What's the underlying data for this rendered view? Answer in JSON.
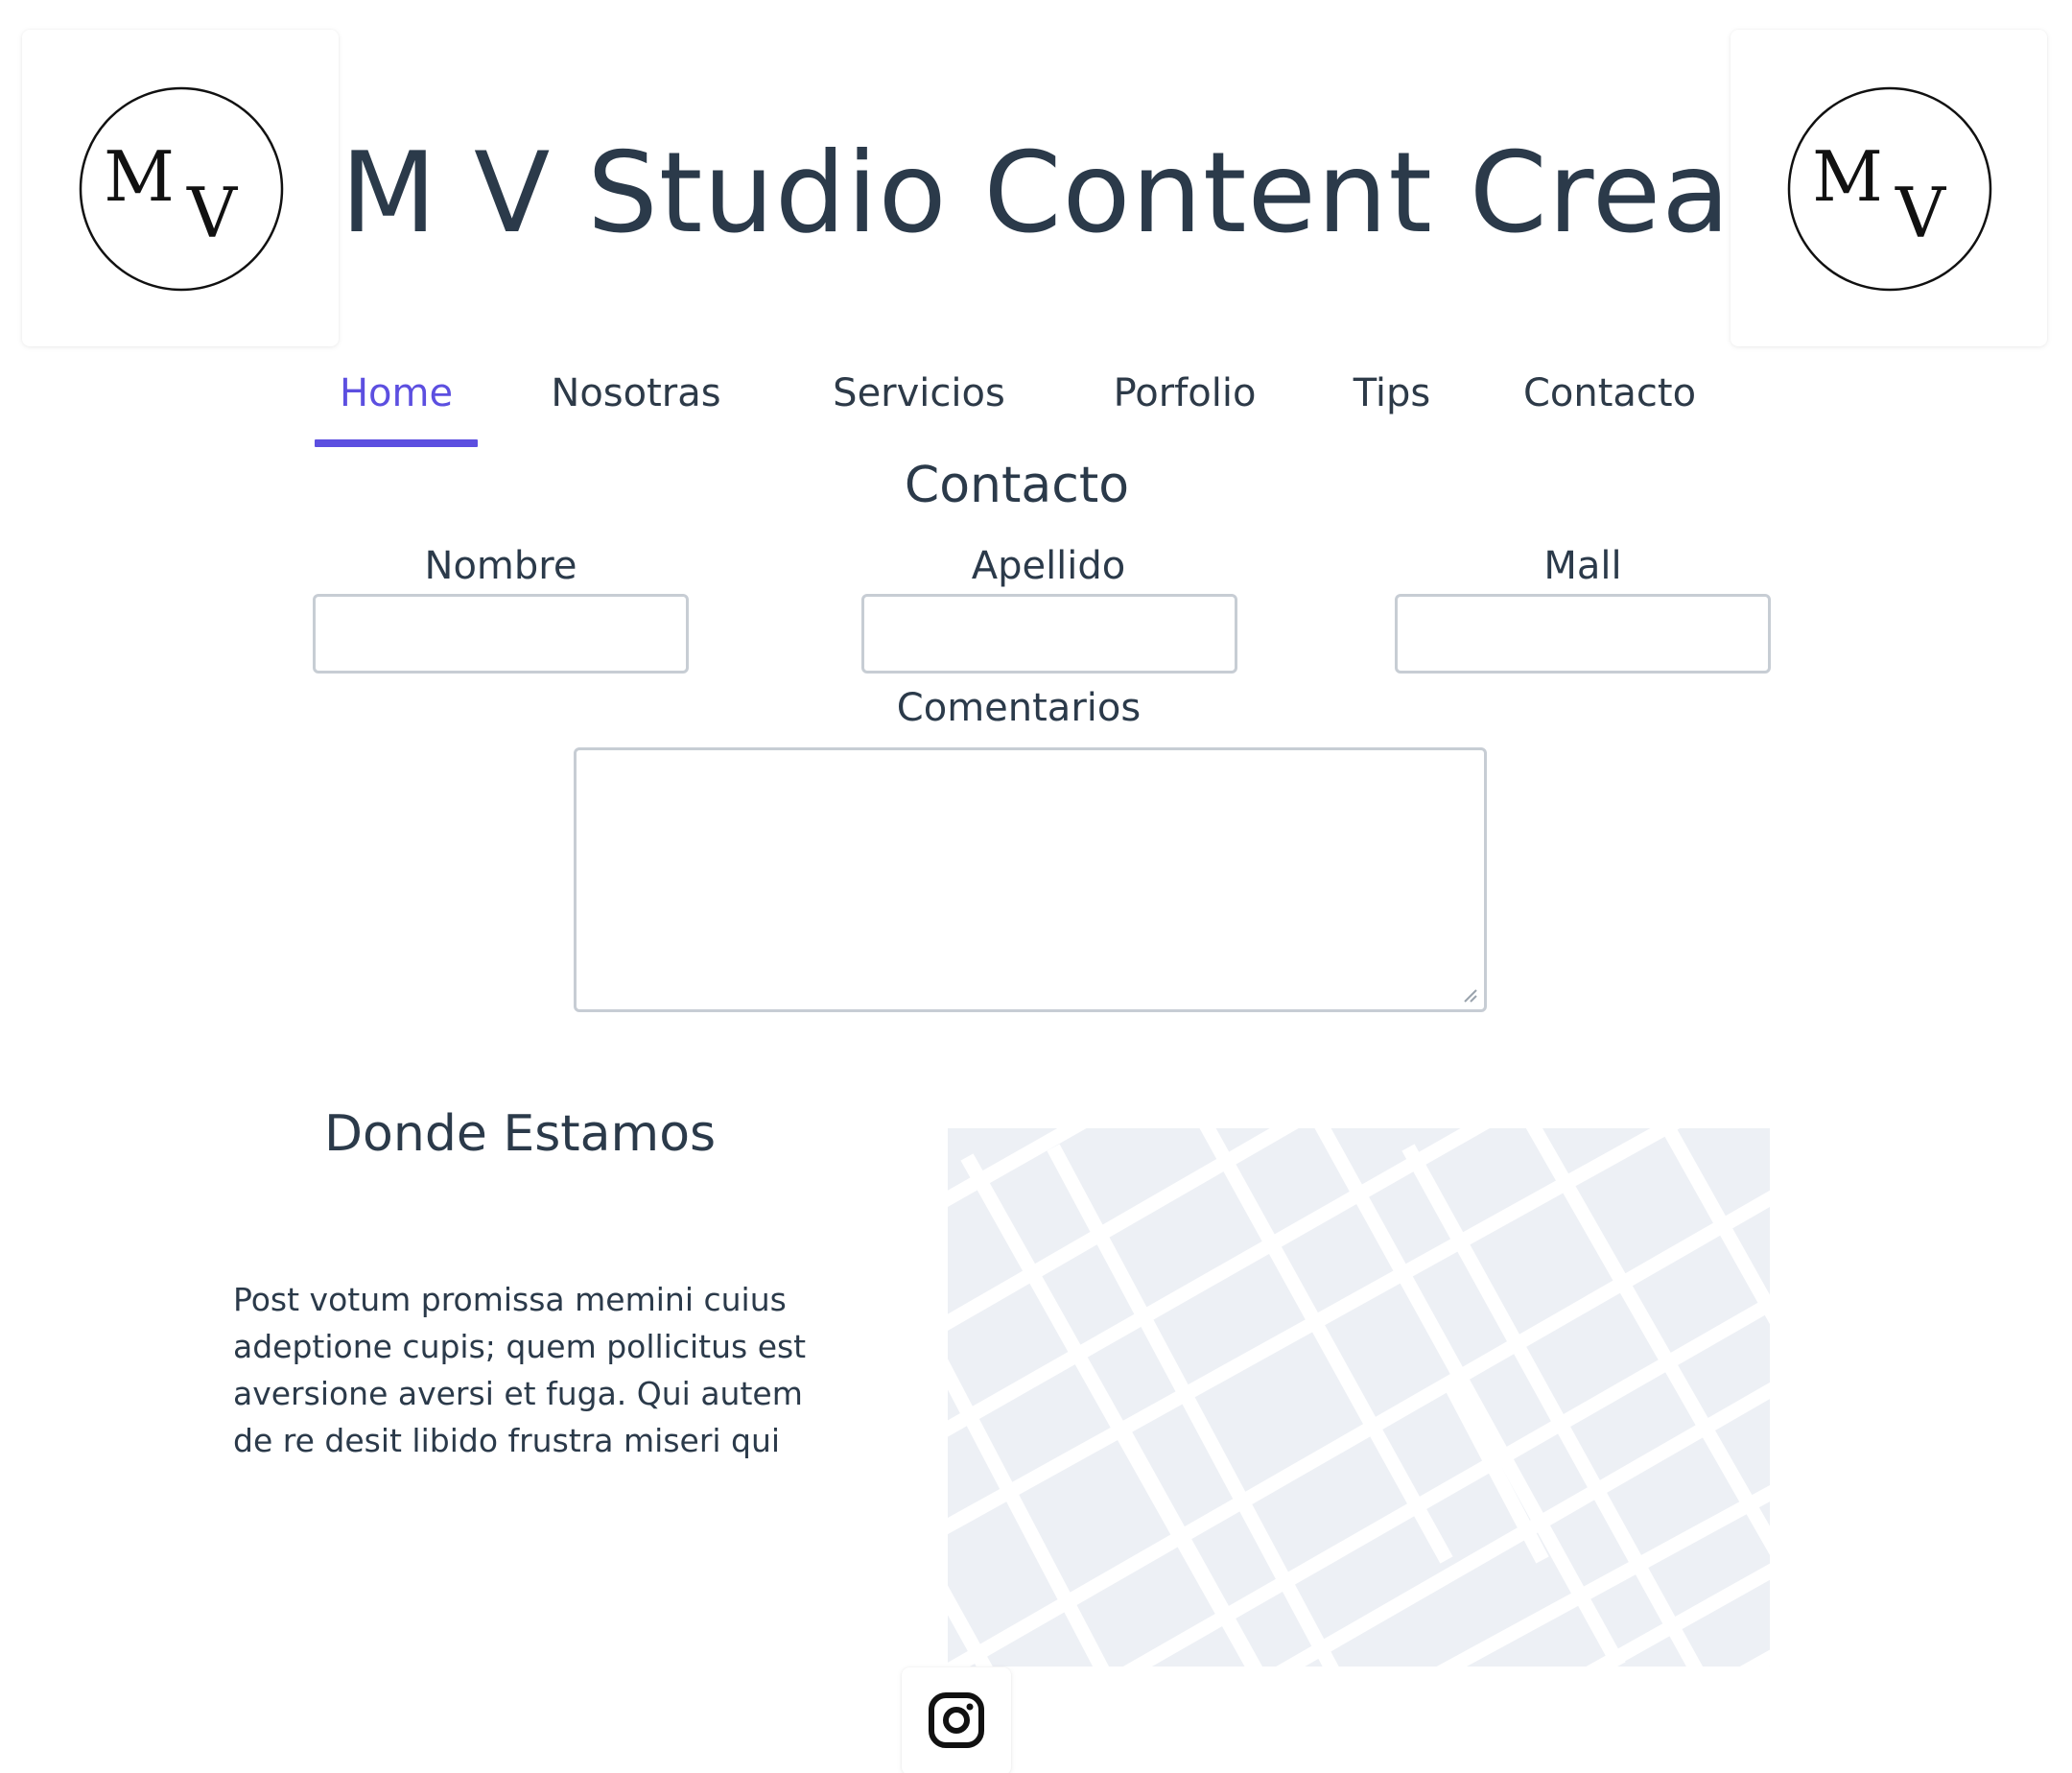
{
  "header": {
    "title": "M V Studio Content Creator",
    "logo_letters": [
      "M",
      "V"
    ]
  },
  "nav": {
    "items": [
      {
        "label": "Home",
        "active": true
      },
      {
        "label": "Nosotras",
        "active": false
      },
      {
        "label": "Servicios",
        "active": false
      },
      {
        "label": "Porfolio",
        "active": false
      },
      {
        "label": "Tips",
        "active": false
      },
      {
        "label": "Contacto",
        "active": false
      }
    ],
    "accent_color": "#5c4fe0"
  },
  "contact_form": {
    "heading": "Contacto",
    "fields": [
      {
        "label": "Nombre",
        "value": "",
        "placeholder": ""
      },
      {
        "label": "Apellido",
        "value": "",
        "placeholder": ""
      },
      {
        "label": "Mall",
        "value": "",
        "placeholder": ""
      }
    ],
    "comments": {
      "label": "Comentarios",
      "value": ""
    }
  },
  "location": {
    "heading": "Donde Estamos",
    "body": "Post votum promissa memini cuius adeptione cupis; quem pollicitus est aversione aversi et fuga. Qui autem de re desit libido frustra miseri qui",
    "map_block_color": "#edf0f5"
  },
  "footer": {
    "social_icon": "instagram-icon"
  }
}
